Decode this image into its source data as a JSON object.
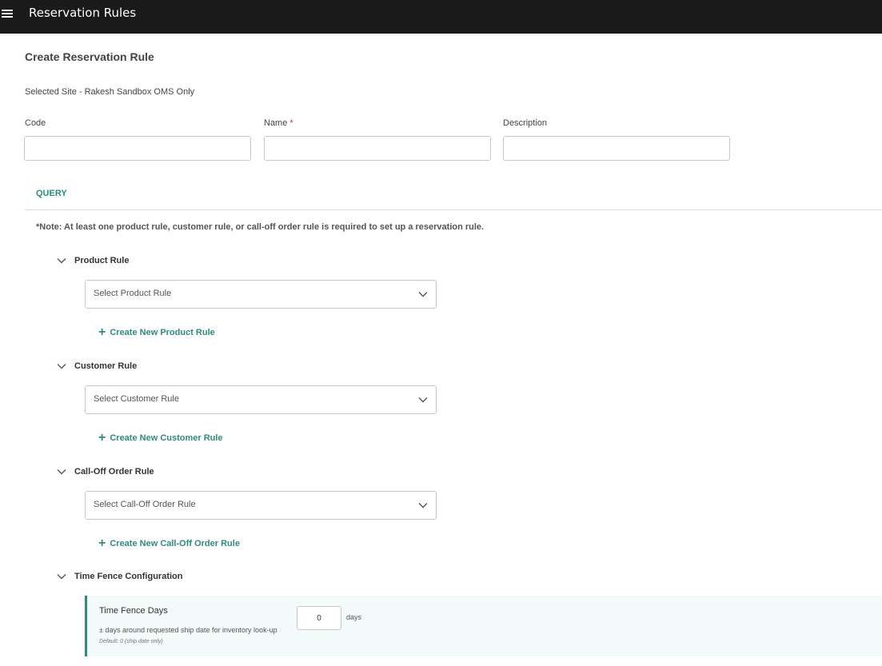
{
  "app": {
    "title": "Reservation Rules"
  },
  "page": {
    "title": "Create Reservation Rule",
    "selected_site": "Selected Site - Rakesh Sandbox OMS Only"
  },
  "form": {
    "code": {
      "label": "Code",
      "value": ""
    },
    "name": {
      "label": "Name",
      "required_mark": "*",
      "value": ""
    },
    "description": {
      "label": "Description",
      "value": ""
    }
  },
  "tabs": {
    "query": "QUERY"
  },
  "note": "*Note: At least one product rule, customer rule, or call-off order rule is required to set up a reservation rule.",
  "sections": {
    "product": {
      "title": "Product Rule",
      "select_placeholder": "Select Product Rule",
      "create_label": "Create New Product Rule"
    },
    "customer": {
      "title": "Customer Rule",
      "select_placeholder": "Select Customer Rule",
      "create_label": "Create New Customer Rule"
    },
    "call_off": {
      "title": "Call-Off Order Rule",
      "select_placeholder": "Select Call-Off Order Rule",
      "create_label": "Create New Call-Off Order Rule"
    },
    "time_fence": {
      "title": "Time Fence Configuration",
      "field_label": "Time Fence Days",
      "description": "± days around requested ship date for inventory look-up",
      "default_text": "Default: 0 (ship date only)",
      "value": "0",
      "unit": "days"
    }
  },
  "icons": {
    "menu": "hamburger-icon",
    "chevron": "chevron-down-icon",
    "plus": "plus-icon"
  },
  "colors": {
    "topbar": "#1a1a1a",
    "accent": "#2e8b7e",
    "required": "#c0392b",
    "time_fence_bg": "#f2fbf9"
  }
}
